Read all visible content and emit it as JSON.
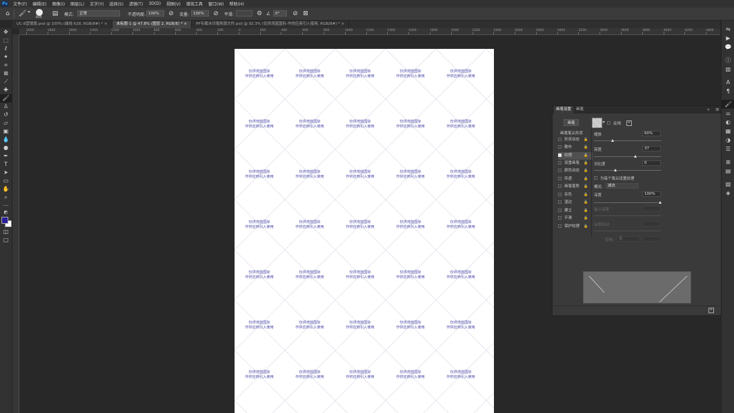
{
  "menubar": {
    "logo": "Ps",
    "items": [
      "文件(F)",
      "编辑(E)",
      "图像(I)",
      "图层(L)",
      "文字(Y)",
      "选择(S)",
      "滤镜(T)",
      "3D(D)",
      "视图(V)",
      "增效工具",
      "窗口(W)",
      "帮助(H)"
    ]
  },
  "options": {
    "brush_size": "600",
    "mode_label": "模式:",
    "mode_value": "正常",
    "opacity_label": "不透明度:",
    "opacity_value": "100%",
    "flow_label": "流量:",
    "flow_value": "100%",
    "smooth_label": "平滑:",
    "smooth_value": "",
    "angle_value": "0°"
  },
  "tabs": [
    {
      "label": "UC-8营销版.psd @ 100% (曲线 628, RGB/8#) *",
      "active": false
    },
    {
      "label": "未标题-1 @ 47.8% (图层 2, RGB/8) *",
      "active": true
    },
    {
      "label": "PP专属水印笔刷源文件.psd @ 92.3% (仅供湾蓝国际 作供应商引入使用, RGB/8#) *",
      "active": false
    }
  ],
  "ruler_top_ticks": [
    "2000",
    "1800",
    "1600",
    "1400",
    "1200",
    "1000",
    "800",
    "600",
    "400",
    "200",
    "0",
    "200",
    "400",
    "600",
    "800",
    "1000",
    "1200",
    "1400",
    "1600",
    "1800",
    "2000",
    "2200",
    "2400",
    "2600",
    "2800",
    "3000",
    "3200",
    "3400",
    "3600",
    "3800",
    "4000",
    "4200",
    "4400"
  ],
  "watermark": {
    "line1": "仅供湾蓝国际",
    "line2": "作供应商引入使用",
    "color": "#4b49a8"
  },
  "brush_panel": {
    "tabs": [
      "画笔设置",
      "画笔"
    ],
    "brush_button": "画笔",
    "invert_label": "反相",
    "tip_shape_label": "画笔笔尖形状",
    "options": [
      {
        "label": "形状动态",
        "checked": false
      },
      {
        "label": "散布",
        "checked": false
      },
      {
        "label": "纹理",
        "checked": true
      },
      {
        "label": "双重画笔",
        "checked": false
      },
      {
        "label": "颜色动态",
        "checked": false
      },
      {
        "label": "传递",
        "checked": false
      },
      {
        "label": "画笔笔势",
        "checked": false
      },
      {
        "label": "杂色",
        "checked": false
      },
      {
        "label": "湿边",
        "checked": false
      },
      {
        "label": "建立",
        "checked": false
      },
      {
        "label": "平滑",
        "checked": false
      },
      {
        "label": "保护纹理",
        "checked": false
      }
    ],
    "scale_label": "缩放",
    "scale_value": "60%",
    "brightness_label": "亮度",
    "brightness_value": "37",
    "contrast_label": "对比度",
    "contrast_value": "0",
    "each_tip_label": "为每个笔尖设置纹理",
    "mode_label": "模式:",
    "mode_value": "减去",
    "depth_label": "深度",
    "depth_value": "100%",
    "min_depth_label": "最小深度",
    "depth_jitter_label": "深度抖动",
    "control_label": "控制:",
    "control_value": "关"
  }
}
